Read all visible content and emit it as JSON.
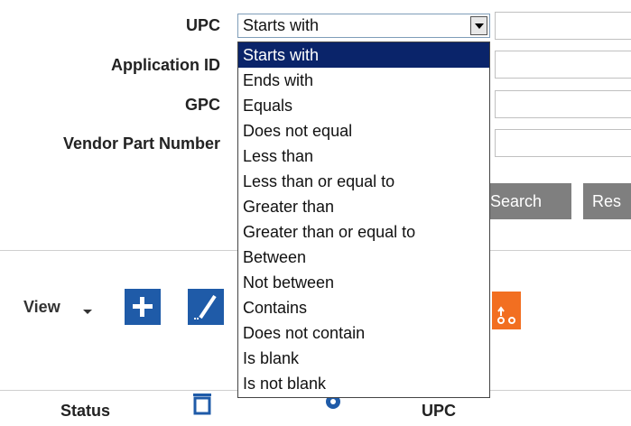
{
  "form": {
    "upc_label": "UPC",
    "application_id_label": "Application ID",
    "gpc_label": "GPC",
    "vendor_part_number_label": "Vendor Part Number",
    "upc_operator_selected": "Starts with",
    "search_button": "Search",
    "reset_button": "Res"
  },
  "dropdown": {
    "options": [
      "Starts with",
      "Ends with",
      "Equals",
      "Does not equal",
      "Less than",
      "Less than or equal to",
      "Greater than",
      "Greater than or equal to",
      "Between",
      "Not between",
      "Contains",
      "Does not contain",
      "Is blank",
      "Is not blank"
    ],
    "selected_index": 0
  },
  "toolbar": {
    "view_label": "View"
  },
  "table": {
    "columns": [
      "Status",
      "UPC"
    ]
  },
  "colors": {
    "selected_bg": "#0a246a",
    "toolbar_blue": "#1f5ba8",
    "toolbar_orange": "#f26f21",
    "button_gray": "#7f7f7f"
  }
}
